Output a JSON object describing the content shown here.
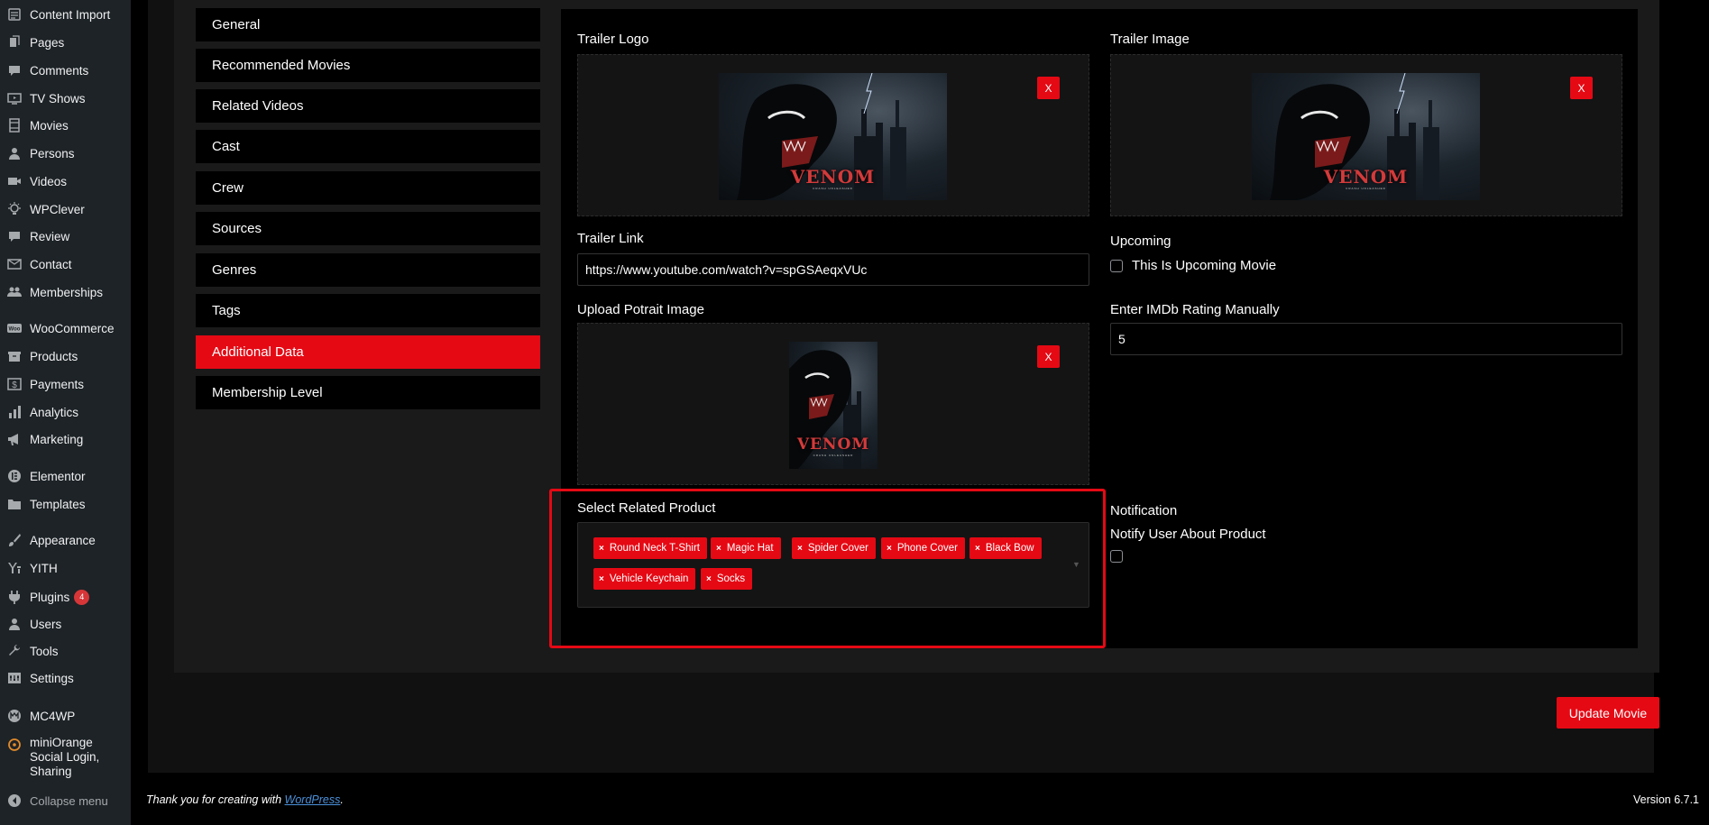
{
  "sidebar": {
    "items": [
      {
        "label": "Content Import",
        "icon": "content-import-icon"
      },
      {
        "label": "Pages",
        "icon": "pages-icon"
      },
      {
        "label": "Comments",
        "icon": "comments-icon"
      },
      {
        "label": "TV Shows",
        "icon": "tv-shows-icon"
      },
      {
        "label": "Movies",
        "icon": "movies-icon"
      },
      {
        "label": "Persons",
        "icon": "persons-icon"
      },
      {
        "label": "Videos",
        "icon": "videos-icon"
      },
      {
        "label": "WPClever",
        "icon": "wpclever-icon"
      },
      {
        "label": "Review",
        "icon": "review-icon"
      },
      {
        "label": "Contact",
        "icon": "contact-icon"
      },
      {
        "label": "Memberships",
        "icon": "memberships-icon"
      },
      {
        "label": "WooCommerce",
        "icon": "woocommerce-icon"
      },
      {
        "label": "Products",
        "icon": "products-icon"
      },
      {
        "label": "Payments",
        "icon": "payments-icon"
      },
      {
        "label": "Analytics",
        "icon": "analytics-icon"
      },
      {
        "label": "Marketing",
        "icon": "marketing-icon"
      },
      {
        "label": "Elementor",
        "icon": "elementor-icon"
      },
      {
        "label": "Templates",
        "icon": "templates-icon"
      },
      {
        "label": "Appearance",
        "icon": "appearance-icon"
      },
      {
        "label": "YITH",
        "icon": "yith-icon"
      },
      {
        "label": "Plugins",
        "icon": "plugins-icon",
        "badge": "4"
      },
      {
        "label": "Users",
        "icon": "users-icon"
      },
      {
        "label": "Tools",
        "icon": "tools-icon"
      },
      {
        "label": "Settings",
        "icon": "settings-icon"
      },
      {
        "label": "MC4WP",
        "icon": "mc4wp-icon"
      },
      {
        "label": "miniOrange Social Login, Sharing",
        "icon": "miniorange-icon"
      }
    ],
    "collapse_label": "Collapse menu"
  },
  "tabs": [
    "General",
    "Recommended Movies",
    "Related Videos",
    "Cast",
    "Crew",
    "Sources",
    "Genres",
    "Tags",
    "Additional Data",
    "Membership Level"
  ],
  "active_tab": "Additional Data",
  "fields": {
    "trailer_logo_label": "Trailer Logo",
    "trailer_image_label": "Trailer Image",
    "trailer_link_label": "Trailer Link",
    "trailer_link_value": "https://www.youtube.com/watch?v=spGSAeqxVUc",
    "upcoming_label": "Upcoming",
    "upcoming_checkbox_label": "This Is Upcoming Movie",
    "portrait_label": "Upload Potrait Image",
    "imdb_label": "Enter IMDb Rating Manually",
    "imdb_value": "5",
    "related_product_label": "Select Related Product",
    "notification_label": "Notification",
    "notify_label": "Notify User About Product",
    "remove_label": "X"
  },
  "poster": {
    "title": "VENOM",
    "subtitle": "CRASH UNLEASHED"
  },
  "related_products": [
    "Round Neck T-Shirt",
    "Magic Hat",
    "Spider Cover",
    "Phone Cover",
    "Black Bow",
    "Vehicle Keychain",
    "Socks"
  ],
  "chip_remove": "×",
  "update_button": "Update Movie",
  "footer": {
    "thanks_prefix": "Thank you for creating with ",
    "wordpress_link": "WordPress",
    "thanks_suffix": ".",
    "version": "Version 6.7.1"
  },
  "colors": {
    "accent": "#e50914",
    "sidebar_bg": "#1d2327",
    "link": "#4a90d9"
  }
}
